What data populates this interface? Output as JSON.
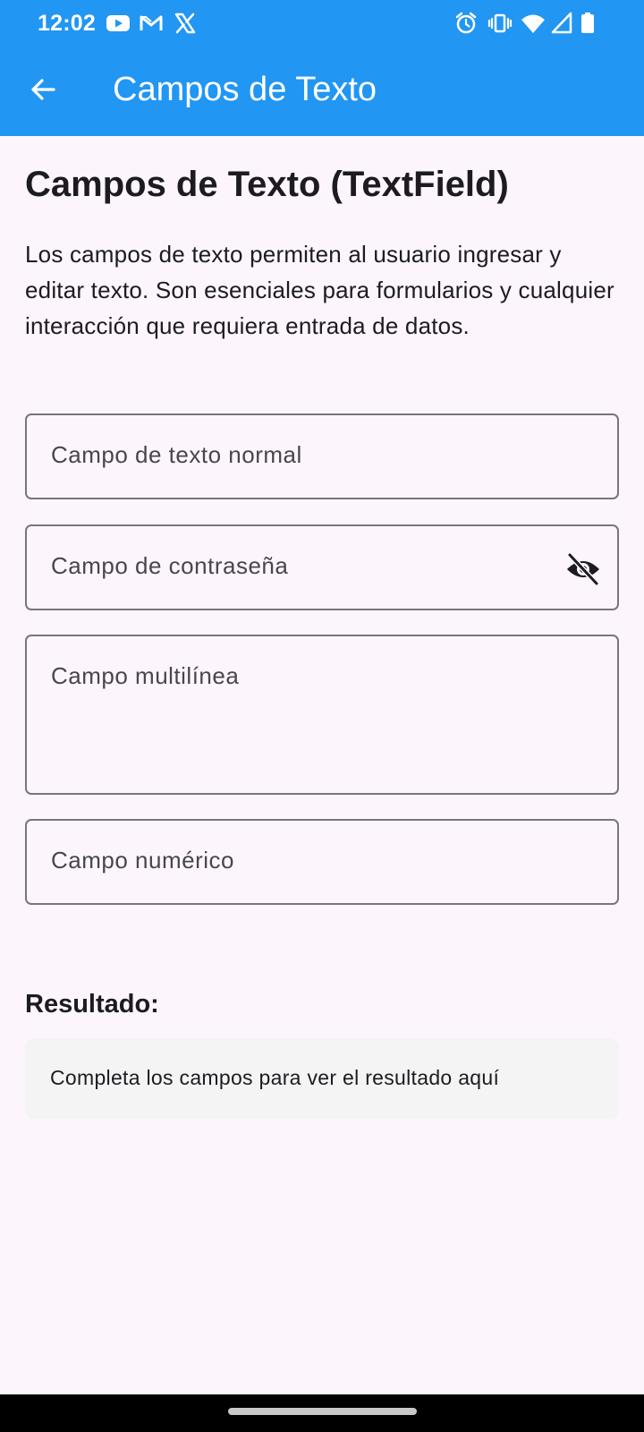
{
  "status_bar": {
    "time": "12:02",
    "left_icons": [
      "youtube-icon",
      "gmail-icon",
      "x-icon"
    ],
    "right_icons": [
      "alarm-icon",
      "vibrate-icon",
      "wifi-icon",
      "signal-icon",
      "battery-icon"
    ]
  },
  "app_bar": {
    "back_icon": "arrow-left-icon",
    "title": "Campos de Texto",
    "color": "#2196f3"
  },
  "main": {
    "heading": "Campos de Texto (TextField)",
    "description": "Los campos de texto permiten al usuario ingresar y editar texto. Son esenciales para formularios y cualquier interacción que requiera entrada de datos.",
    "fields": [
      {
        "placeholder": "Campo de texto normal",
        "value": ""
      },
      {
        "placeholder": "Campo de contraseña",
        "value": "",
        "trailing_icon": "visibility-off-icon"
      },
      {
        "placeholder": "Campo multilínea",
        "value": ""
      },
      {
        "placeholder": "Campo numérico",
        "value": ""
      }
    ],
    "result_label": "Resultado:",
    "result_text": "Completa los campos para ver el resultado aquí"
  }
}
